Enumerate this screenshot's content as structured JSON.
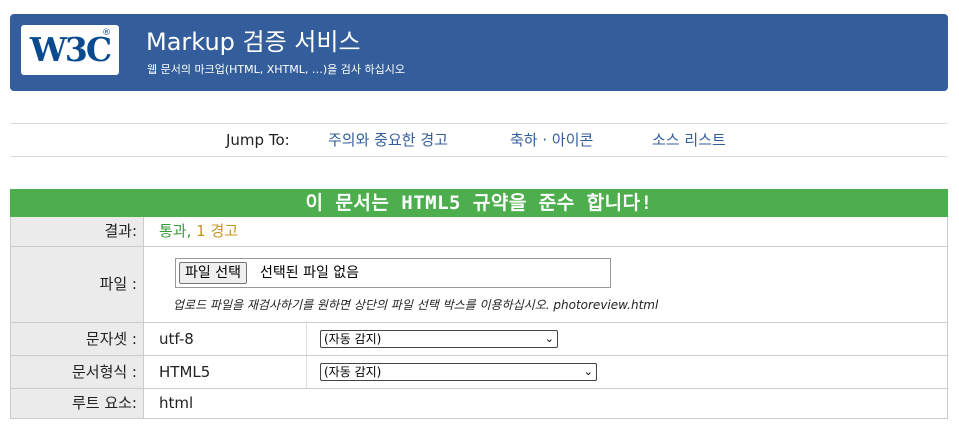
{
  "header": {
    "logo_text": "W3C",
    "logo_reg": "®",
    "title": "Markup 검증 서비스",
    "subtitle": "웹 문서의 마크업(HTML, XHTML, …)을 검사 하십시오"
  },
  "jump_nav": {
    "label": "Jump To:",
    "links": [
      "주의와 중요한 경고",
      "축하 · 아이콘",
      "소스 리스트"
    ]
  },
  "result": {
    "banner": "이 문서는 HTML5 규약을 준수 합니다!",
    "rows": {
      "result": {
        "label": "결과:",
        "pass": "통과,",
        "warnings": " 1 경고"
      },
      "file": {
        "label": "파일 :",
        "button": "파일 선택",
        "status": "선택된 파일 없음",
        "hint": "업로드 파일을 재검사하기를 원하면 상단의 파일 선택 박스를 이용하십시오. photoreview.html"
      },
      "charset": {
        "label": "문자셋 :",
        "value": "utf-8",
        "select": "(자동 감지)"
      },
      "doctype": {
        "label": "문서형식 :",
        "value": "HTML5",
        "select": "(자동 감지)"
      },
      "root": {
        "label": "루트 요소:",
        "value": "html"
      }
    }
  },
  "colors": {
    "banner": "#335e9b",
    "success": "#4cae4c",
    "warning": "#c8951b",
    "link": "#335e9b"
  }
}
